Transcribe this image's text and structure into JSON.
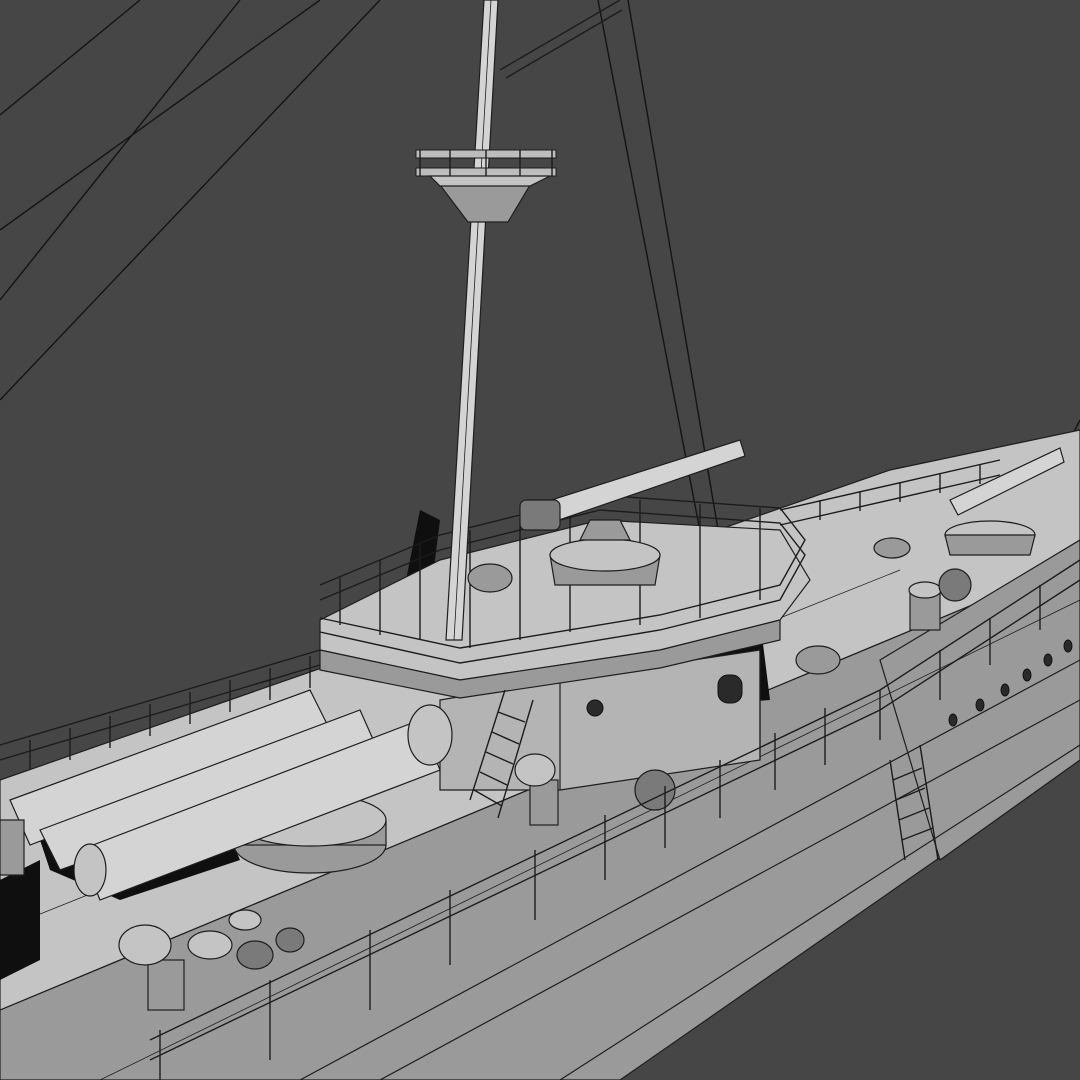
{
  "viewport": {
    "background": "#464646",
    "subject": "ship-wireframe-render"
  },
  "palette": {
    "background": "#464646",
    "surface_light": "#c4c4c4",
    "surface_mid": "#9a9a9a",
    "wire": "#1e1e1e",
    "shadow": "#0f0f0f"
  }
}
